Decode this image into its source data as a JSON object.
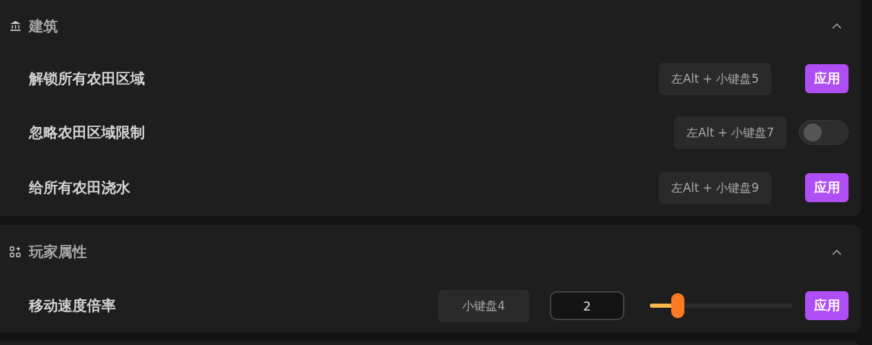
{
  "sections": [
    {
      "title": "建筑",
      "expanded": true,
      "items": [
        {
          "kind": "button",
          "label": "解锁所有农田区域",
          "hotkey": "左Alt + 小键盘5",
          "button": "应用"
        },
        {
          "kind": "toggle",
          "label": "忽略农田区域限制",
          "hotkey": "左Alt + 小键盘7",
          "on": false
        },
        {
          "kind": "button",
          "label": "给所有农田浇水",
          "hotkey": "左Alt + 小键盘9",
          "button": "应用"
        }
      ]
    },
    {
      "title": "玩家属性",
      "expanded": true,
      "items": [
        {
          "kind": "slider",
          "label": "移动速度倍率",
          "hotkey": "小键盘4",
          "value": "2",
          "level": 0.2,
          "button": "应用"
        }
      ]
    }
  ]
}
